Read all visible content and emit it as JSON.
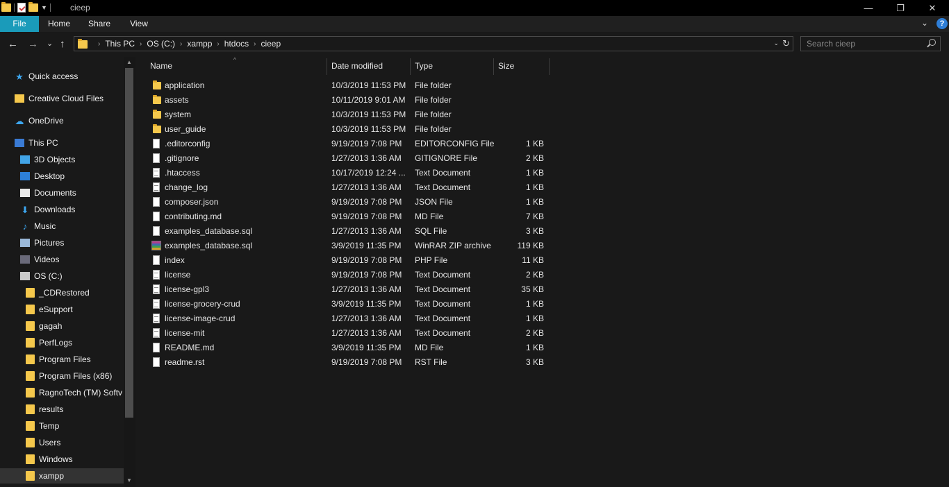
{
  "window": {
    "title": "cieep",
    "minimize_glyph": "—",
    "maximize_glyph": "❐",
    "close_glyph": "✕"
  },
  "ribbon": {
    "tabs": [
      "File",
      "Home",
      "Share",
      "View"
    ],
    "collapse_glyph": "⌄",
    "help_glyph": "?"
  },
  "navigation": {
    "back_glyph": "←",
    "forward_glyph": "→",
    "recent_glyph": "⌄",
    "up_glyph": "↑",
    "breadcrumbs": [
      "This PC",
      "OS (C:)",
      "xampp",
      "htdocs",
      "cieep"
    ],
    "crumb_separator": "›",
    "refresh_glyph": "↻",
    "dropdown_glyph": "⌄"
  },
  "search": {
    "placeholder": "Search cieep"
  },
  "sidebar": {
    "items": [
      {
        "label": "Quick access",
        "icon": "star-icon"
      },
      {
        "label": "Creative Cloud Files",
        "icon": "creative-cloud-icon"
      },
      {
        "label": "OneDrive",
        "icon": "cloud-icon"
      },
      {
        "label": "This PC",
        "icon": "computer-icon"
      },
      {
        "label": "3D Objects",
        "icon": "cube-icon"
      },
      {
        "label": "Desktop",
        "icon": "desktop-icon"
      },
      {
        "label": "Documents",
        "icon": "document-icon"
      },
      {
        "label": "Downloads",
        "icon": "download-icon"
      },
      {
        "label": "Music",
        "icon": "music-icon"
      },
      {
        "label": "Pictures",
        "icon": "picture-icon"
      },
      {
        "label": "Videos",
        "icon": "video-icon"
      },
      {
        "label": "OS (C:)",
        "icon": "drive-icon"
      },
      {
        "label": "_CDRestored",
        "icon": "folder-icon"
      },
      {
        "label": "eSupport",
        "icon": "folder-icon"
      },
      {
        "label": "gagah",
        "icon": "folder-icon"
      },
      {
        "label": "PerfLogs",
        "icon": "folder-icon"
      },
      {
        "label": "Program Files",
        "icon": "folder-icon"
      },
      {
        "label": "Program Files (x86)",
        "icon": "folder-icon"
      },
      {
        "label": "RagnoTech (TM) Softv",
        "icon": "folder-icon"
      },
      {
        "label": "results",
        "icon": "folder-icon"
      },
      {
        "label": "Temp",
        "icon": "folder-icon"
      },
      {
        "label": "Users",
        "icon": "folder-icon"
      },
      {
        "label": "Windows",
        "icon": "folder-icon"
      },
      {
        "label": "xampp",
        "icon": "folder-icon"
      }
    ],
    "selected": "xampp"
  },
  "columns": {
    "name": "Name",
    "date": "Date modified",
    "type": "Type",
    "size": "Size",
    "sort_glyph": "^"
  },
  "files": [
    {
      "name": "application",
      "date": "10/3/2019 11:53 PM",
      "type": "File folder",
      "size": "",
      "icon": "folder-icon"
    },
    {
      "name": "assets",
      "date": "10/11/2019 9:01 AM",
      "type": "File folder",
      "size": "",
      "icon": "folder-icon"
    },
    {
      "name": "system",
      "date": "10/3/2019 11:53 PM",
      "type": "File folder",
      "size": "",
      "icon": "folder-icon"
    },
    {
      "name": "user_guide",
      "date": "10/3/2019 11:53 PM",
      "type": "File folder",
      "size": "",
      "icon": "folder-icon"
    },
    {
      "name": ".editorconfig",
      "date": "9/19/2019 7:08 PM",
      "type": "EDITORCONFIG File",
      "size": "1 KB",
      "icon": "file-icon"
    },
    {
      "name": ".gitignore",
      "date": "1/27/2013 1:36 AM",
      "type": "GITIGNORE File",
      "size": "2 KB",
      "icon": "file-icon"
    },
    {
      "name": ".htaccess",
      "date": "10/17/2019 12:24 ...",
      "type": "Text Document",
      "size": "1 KB",
      "icon": "text-document-icon"
    },
    {
      "name": "change_log",
      "date": "1/27/2013 1:36 AM",
      "type": "Text Document",
      "size": "1 KB",
      "icon": "text-document-icon"
    },
    {
      "name": "composer.json",
      "date": "9/19/2019 7:08 PM",
      "type": "JSON File",
      "size": "1 KB",
      "icon": "file-icon"
    },
    {
      "name": "contributing.md",
      "date": "9/19/2019 7:08 PM",
      "type": "MD File",
      "size": "7 KB",
      "icon": "file-icon"
    },
    {
      "name": "examples_database.sql",
      "date": "1/27/2013 1:36 AM",
      "type": "SQL File",
      "size": "3 KB",
      "icon": "file-icon"
    },
    {
      "name": "examples_database.sql",
      "date": "3/9/2019 11:35 PM",
      "type": "WinRAR ZIP archive",
      "size": "119 KB",
      "icon": "winrar-archive-icon"
    },
    {
      "name": "index",
      "date": "9/19/2019 7:08 PM",
      "type": "PHP File",
      "size": "11 KB",
      "icon": "file-icon"
    },
    {
      "name": "license",
      "date": "9/19/2019 7:08 PM",
      "type": "Text Document",
      "size": "2 KB",
      "icon": "text-document-icon"
    },
    {
      "name": "license-gpl3",
      "date": "1/27/2013 1:36 AM",
      "type": "Text Document",
      "size": "35 KB",
      "icon": "text-document-icon"
    },
    {
      "name": "license-grocery-crud",
      "date": "3/9/2019 11:35 PM",
      "type": "Text Document",
      "size": "1 KB",
      "icon": "text-document-icon"
    },
    {
      "name": "license-image-crud",
      "date": "1/27/2013 1:36 AM",
      "type": "Text Document",
      "size": "1 KB",
      "icon": "text-document-icon"
    },
    {
      "name": "license-mit",
      "date": "1/27/2013 1:36 AM",
      "type": "Text Document",
      "size": "2 KB",
      "icon": "text-document-icon"
    },
    {
      "name": "README.md",
      "date": "3/9/2019 11:35 PM",
      "type": "MD File",
      "size": "1 KB",
      "icon": "file-icon"
    },
    {
      "name": "readme.rst",
      "date": "9/19/2019 7:08 PM",
      "type": "RST File",
      "size": "3 KB",
      "icon": "file-icon"
    }
  ],
  "colors": {
    "accent": "#1a9bba",
    "background": "#191919",
    "folder": "#f5c84c"
  }
}
